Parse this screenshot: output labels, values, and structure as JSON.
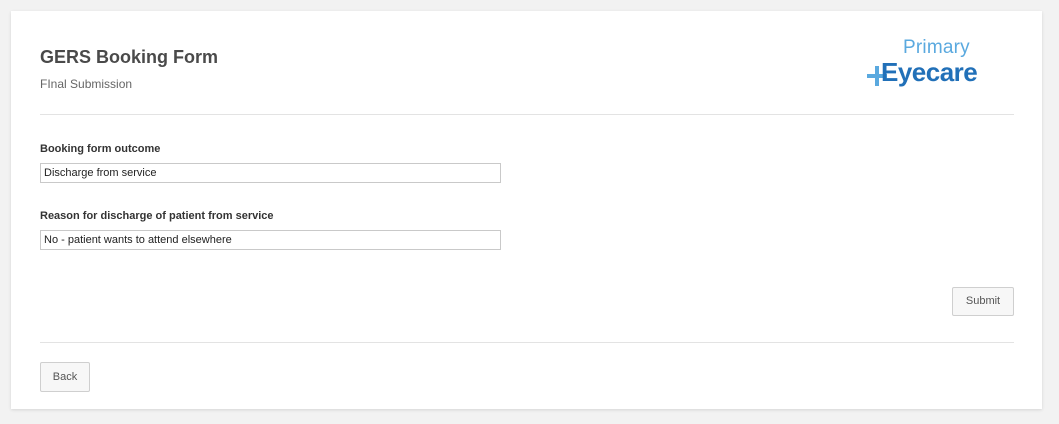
{
  "header": {
    "title": "GERS Booking Form",
    "subtitle": "FInal Submission"
  },
  "logo": {
    "line1": "Primary",
    "line2": "Eyecare",
    "plus_icon": "plus-icon",
    "colors": {
      "primary": "#5aa9df",
      "eyecare": "#2170b8"
    }
  },
  "form": {
    "outcome_label": "Booking form outcome",
    "outcome_value": "Discharge from service",
    "reason_label": "Reason for discharge of patient from service",
    "reason_value": "No - patient wants to attend elsewhere"
  },
  "actions": {
    "submit_label": "Submit",
    "back_label": "Back"
  }
}
